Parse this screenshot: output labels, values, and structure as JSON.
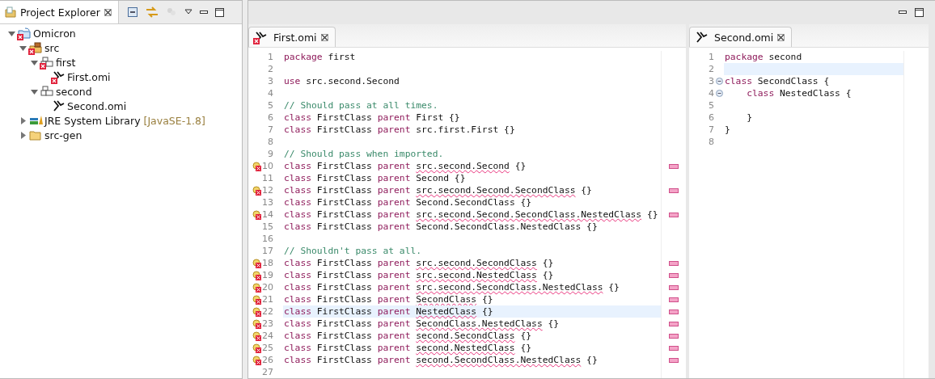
{
  "explorer": {
    "title": "Project Explorer",
    "tree": [
      {
        "label": "Omicron",
        "kind": "project",
        "error": true,
        "expanded": true,
        "children": [
          {
            "label": "src",
            "kind": "source-folder",
            "error": true,
            "expanded": true,
            "children": [
              {
                "label": "first",
                "kind": "package",
                "error": true,
                "expanded": true,
                "children": [
                  {
                    "label": "First.omi",
                    "kind": "file",
                    "error": true
                  }
                ]
              },
              {
                "label": "second",
                "kind": "package",
                "error": false,
                "expanded": true,
                "children": [
                  {
                    "label": "Second.omi",
                    "kind": "file",
                    "error": false
                  }
                ]
              }
            ]
          },
          {
            "label": "JRE System Library",
            "decoration": "[JavaSE-1.8]",
            "kind": "library",
            "error": false,
            "expanded": false
          },
          {
            "label": "src-gen",
            "kind": "folder",
            "error": false,
            "expanded": false
          }
        ]
      }
    ]
  },
  "editors": [
    {
      "tab": {
        "title": "First.omi",
        "error": true
      },
      "lines": [
        {
          "number": "1",
          "error": false,
          "current": false,
          "fold": false,
          "segments": [
            {
              "kind": "keyword",
              "text": "package"
            },
            {
              "kind": "plain",
              "text": " first"
            }
          ]
        },
        {
          "number": "2",
          "error": false,
          "current": false,
          "fold": false
        },
        {
          "number": "3",
          "error": false,
          "current": false,
          "fold": false,
          "segments": [
            {
              "kind": "keyword",
              "text": "use"
            },
            {
              "kind": "plain",
              "text": " src.second.Second"
            }
          ]
        },
        {
          "number": "4",
          "error": false,
          "current": false,
          "fold": false
        },
        {
          "number": "5",
          "error": false,
          "current": false,
          "fold": false,
          "segments": [
            {
              "kind": "comment",
              "text": "// Should pass at all times."
            }
          ]
        },
        {
          "number": "6",
          "error": false,
          "current": false,
          "fold": false,
          "segments": [
            {
              "kind": "keyword",
              "text": "class"
            },
            {
              "kind": "plain",
              "text": " FirstClass "
            },
            {
              "kind": "keyword",
              "text": "parent"
            },
            {
              "kind": "plain",
              "text": " First {}"
            }
          ]
        },
        {
          "number": "7",
          "error": false,
          "current": false,
          "fold": false,
          "segments": [
            {
              "kind": "keyword",
              "text": "class"
            },
            {
              "kind": "plain",
              "text": " FirstClass "
            },
            {
              "kind": "keyword",
              "text": "parent"
            },
            {
              "kind": "plain",
              "text": " src.first.First {}"
            }
          ]
        },
        {
          "number": "8",
          "error": false,
          "current": false,
          "fold": false
        },
        {
          "number": "9",
          "error": false,
          "current": false,
          "fold": false,
          "segments": [
            {
              "kind": "comment",
              "text": "// Should pass when imported."
            }
          ]
        },
        {
          "number": "10",
          "error": true,
          "current": false,
          "fold": false,
          "segments": [
            {
              "kind": "keyword",
              "text": "class"
            },
            {
              "kind": "plain",
              "text": " FirstClass "
            },
            {
              "kind": "keyword",
              "text": "parent "
            },
            {
              "kind": "error",
              "text": "src.second.Second"
            },
            {
              "kind": "plain",
              "text": " {}"
            }
          ]
        },
        {
          "number": "11",
          "error": false,
          "current": false,
          "fold": false,
          "segments": [
            {
              "kind": "keyword",
              "text": "class"
            },
            {
              "kind": "plain",
              "text": " FirstClass "
            },
            {
              "kind": "keyword",
              "text": "parent"
            },
            {
              "kind": "plain",
              "text": " Second {}"
            }
          ]
        },
        {
          "number": "12",
          "error": true,
          "current": false,
          "fold": false,
          "segments": [
            {
              "kind": "keyword",
              "text": "class"
            },
            {
              "kind": "plain",
              "text": " FirstClass "
            },
            {
              "kind": "keyword",
              "text": "parent "
            },
            {
              "kind": "error",
              "text": "src.second.Second.SecondClass"
            },
            {
              "kind": "plain",
              "text": " {}"
            }
          ]
        },
        {
          "number": "13",
          "error": false,
          "current": false,
          "fold": false,
          "segments": [
            {
              "kind": "keyword",
              "text": "class"
            },
            {
              "kind": "plain",
              "text": " FirstClass "
            },
            {
              "kind": "keyword",
              "text": "parent"
            },
            {
              "kind": "plain",
              "text": " Second.SecondClass {}"
            }
          ]
        },
        {
          "number": "14",
          "error": true,
          "current": false,
          "fold": false,
          "segments": [
            {
              "kind": "keyword",
              "text": "class"
            },
            {
              "kind": "plain",
              "text": " FirstClass "
            },
            {
              "kind": "keyword",
              "text": "parent "
            },
            {
              "kind": "error",
              "text": "src.second.Second.SecondClass.NestedClass"
            },
            {
              "kind": "plain",
              "text": " {}"
            }
          ]
        },
        {
          "number": "15",
          "error": false,
          "current": false,
          "fold": false,
          "segments": [
            {
              "kind": "keyword",
              "text": "class"
            },
            {
              "kind": "plain",
              "text": " FirstClass "
            },
            {
              "kind": "keyword",
              "text": "parent"
            },
            {
              "kind": "plain",
              "text": " Second.SecondClass.NestedClass {}"
            }
          ]
        },
        {
          "number": "16",
          "error": false,
          "current": false,
          "fold": false
        },
        {
          "number": "17",
          "error": false,
          "current": false,
          "fold": false,
          "segments": [
            {
              "kind": "comment",
              "text": "// Shouldn't pass at all."
            }
          ]
        },
        {
          "number": "18",
          "error": true,
          "current": false,
          "fold": false,
          "segments": [
            {
              "kind": "keyword",
              "text": "class"
            },
            {
              "kind": "plain",
              "text": " FirstClass "
            },
            {
              "kind": "keyword",
              "text": "parent "
            },
            {
              "kind": "error",
              "text": "src.second.SecondClass"
            },
            {
              "kind": "plain",
              "text": " {}"
            }
          ]
        },
        {
          "number": "19",
          "error": true,
          "current": false,
          "fold": false,
          "segments": [
            {
              "kind": "keyword",
              "text": "class"
            },
            {
              "kind": "plain",
              "text": " FirstClass "
            },
            {
              "kind": "keyword",
              "text": "parent "
            },
            {
              "kind": "error",
              "text": "src.second.NestedClass"
            },
            {
              "kind": "plain",
              "text": " {}"
            }
          ]
        },
        {
          "number": "20",
          "error": true,
          "current": false,
          "fold": false,
          "segments": [
            {
              "kind": "keyword",
              "text": "class"
            },
            {
              "kind": "plain",
              "text": " FirstClass "
            },
            {
              "kind": "keyword",
              "text": "parent "
            },
            {
              "kind": "error",
              "text": "src.second.SecondClass.NestedClass"
            },
            {
              "kind": "plain",
              "text": " {}"
            }
          ]
        },
        {
          "number": "21",
          "error": true,
          "current": false,
          "fold": false,
          "segments": [
            {
              "kind": "keyword",
              "text": "class"
            },
            {
              "kind": "plain",
              "text": " FirstClass "
            },
            {
              "kind": "keyword",
              "text": "parent "
            },
            {
              "kind": "error",
              "text": "SecondClass"
            },
            {
              "kind": "plain",
              "text": " {}"
            }
          ]
        },
        {
          "number": "22",
          "error": true,
          "current": true,
          "fold": false,
          "segments": [
            {
              "kind": "keyword",
              "text": "class"
            },
            {
              "kind": "plain",
              "text": " FirstClass "
            },
            {
              "kind": "keyword",
              "text": "parent "
            },
            {
              "kind": "error",
              "text": "NestedClass"
            },
            {
              "kind": "plain",
              "text": " {}"
            }
          ]
        },
        {
          "number": "23",
          "error": true,
          "current": false,
          "fold": false,
          "segments": [
            {
              "kind": "keyword",
              "text": "class"
            },
            {
              "kind": "plain",
              "text": " FirstClass "
            },
            {
              "kind": "keyword",
              "text": "parent "
            },
            {
              "kind": "error",
              "text": "SecondClass.NestedClass"
            },
            {
              "kind": "plain",
              "text": " {}"
            }
          ]
        },
        {
          "number": "24",
          "error": true,
          "current": false,
          "fold": false,
          "segments": [
            {
              "kind": "keyword",
              "text": "class"
            },
            {
              "kind": "plain",
              "text": " FirstClass "
            },
            {
              "kind": "keyword",
              "text": "parent "
            },
            {
              "kind": "error",
              "text": "second.SecondClass"
            },
            {
              "kind": "plain",
              "text": " {}"
            }
          ]
        },
        {
          "number": "25",
          "error": true,
          "current": false,
          "fold": false,
          "segments": [
            {
              "kind": "keyword",
              "text": "class"
            },
            {
              "kind": "plain",
              "text": " FirstClass "
            },
            {
              "kind": "keyword",
              "text": "parent "
            },
            {
              "kind": "error",
              "text": "second.NestedClass"
            },
            {
              "kind": "plain",
              "text": " {}"
            }
          ]
        },
        {
          "number": "26",
          "error": true,
          "current": false,
          "fold": false,
          "segments": [
            {
              "kind": "keyword",
              "text": "class"
            },
            {
              "kind": "plain",
              "text": " FirstClass "
            },
            {
              "kind": "keyword",
              "text": "parent "
            },
            {
              "kind": "error",
              "text": "second.SecondClass.NestedClass"
            },
            {
              "kind": "plain",
              "text": " {}"
            }
          ]
        },
        {
          "number": "27",
          "error": false,
          "current": false,
          "fold": false
        }
      ]
    },
    {
      "tab": {
        "title": "Second.omi",
        "error": false
      },
      "lines": [
        {
          "number": "1",
          "error": false,
          "current": false,
          "fold": false,
          "segments": [
            {
              "kind": "keyword",
              "text": "package"
            },
            {
              "kind": "plain",
              "text": " second"
            }
          ]
        },
        {
          "number": "2",
          "error": false,
          "current": true,
          "fold": false
        },
        {
          "number": "3",
          "error": false,
          "current": false,
          "fold": true,
          "segments": [
            {
              "kind": "keyword",
              "text": "class"
            },
            {
              "kind": "plain",
              "text": " SecondClass {"
            }
          ]
        },
        {
          "number": "4",
          "error": false,
          "current": false,
          "fold": true,
          "segments": [
            {
              "kind": "keyword",
              "text": "    class"
            },
            {
              "kind": "plain",
              "text": " NestedClass {"
            }
          ]
        },
        {
          "number": "5",
          "error": false,
          "current": false,
          "fold": false
        },
        {
          "number": "6",
          "error": false,
          "current": false,
          "fold": false,
          "segments": [
            {
              "kind": "plain",
              "text": "    }"
            }
          ]
        },
        {
          "number": "7",
          "error": false,
          "current": false,
          "fold": false,
          "segments": [
            {
              "kind": "plain",
              "text": "}"
            }
          ]
        },
        {
          "number": "8",
          "error": false,
          "current": false,
          "fold": false
        }
      ]
    }
  ]
}
